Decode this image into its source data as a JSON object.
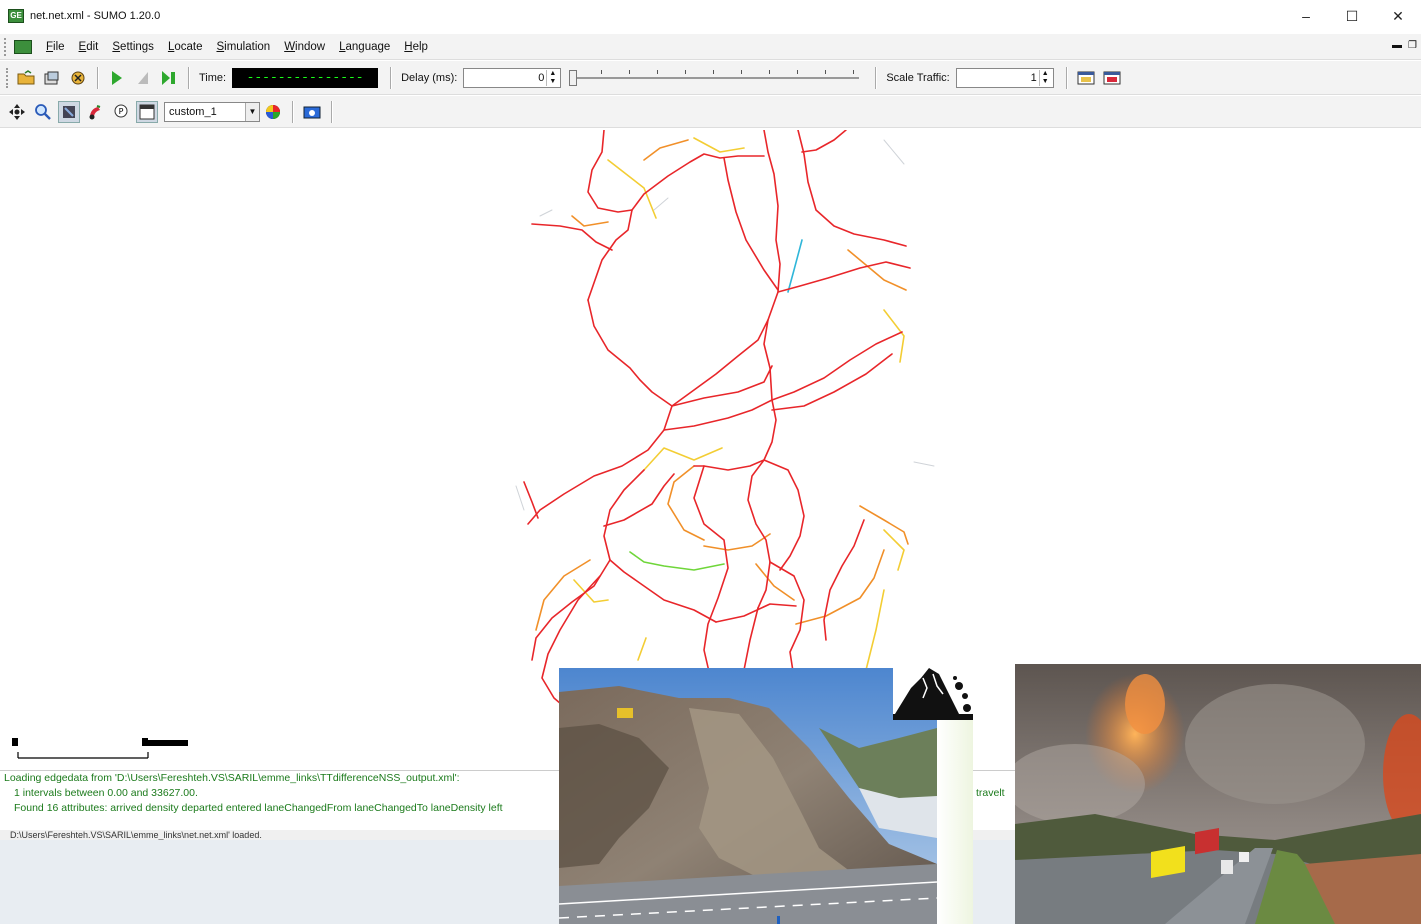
{
  "window": {
    "title": "net.net.xml - SUMO 1.20.0",
    "app_icon": "sumo-logo-icon",
    "controls": {
      "minimize": "–",
      "maximize": "☐",
      "close": "✕"
    }
  },
  "menubar": {
    "items": [
      "File",
      "Edit",
      "Settings",
      "Locate",
      "Simulation",
      "Window",
      "Language",
      "Help"
    ]
  },
  "toolbar": {
    "time_label": "Time:",
    "time_value": "---------------",
    "delay_label": "Delay (ms):",
    "delay_value": "0",
    "scale_traffic_label": "Scale Traffic:",
    "scale_traffic_value": "1"
  },
  "view_toolbar": {
    "scheme_selected": "custom_1"
  },
  "messages": {
    "line1": "Loading edgedata from 'D:\\Users\\Fereshteh.VS\\SARIL\\emme_links\\TTdifferenceNSS_output.xml':",
    "line2": "  1 intervals between 0.00 and 33627.00.",
    "line3": "  Found 16 attributes: arrived density departed entered laneChangedFrom laneChangedTo laneDensity left",
    "line3_tail": "travelt"
  },
  "statusbar": {
    "text": "D:\\Users\\Fereshteh.VS\\SARIL\\emme_links\\net.net.xml' loaded."
  },
  "colors": {
    "road_main": "#e8262a",
    "road_mid": "#f08a1e",
    "road_low": "#f2c81e",
    "road_green": "#6fd63a",
    "road_cyan": "#2fb6d9",
    "time_fg": "#19ff19"
  }
}
